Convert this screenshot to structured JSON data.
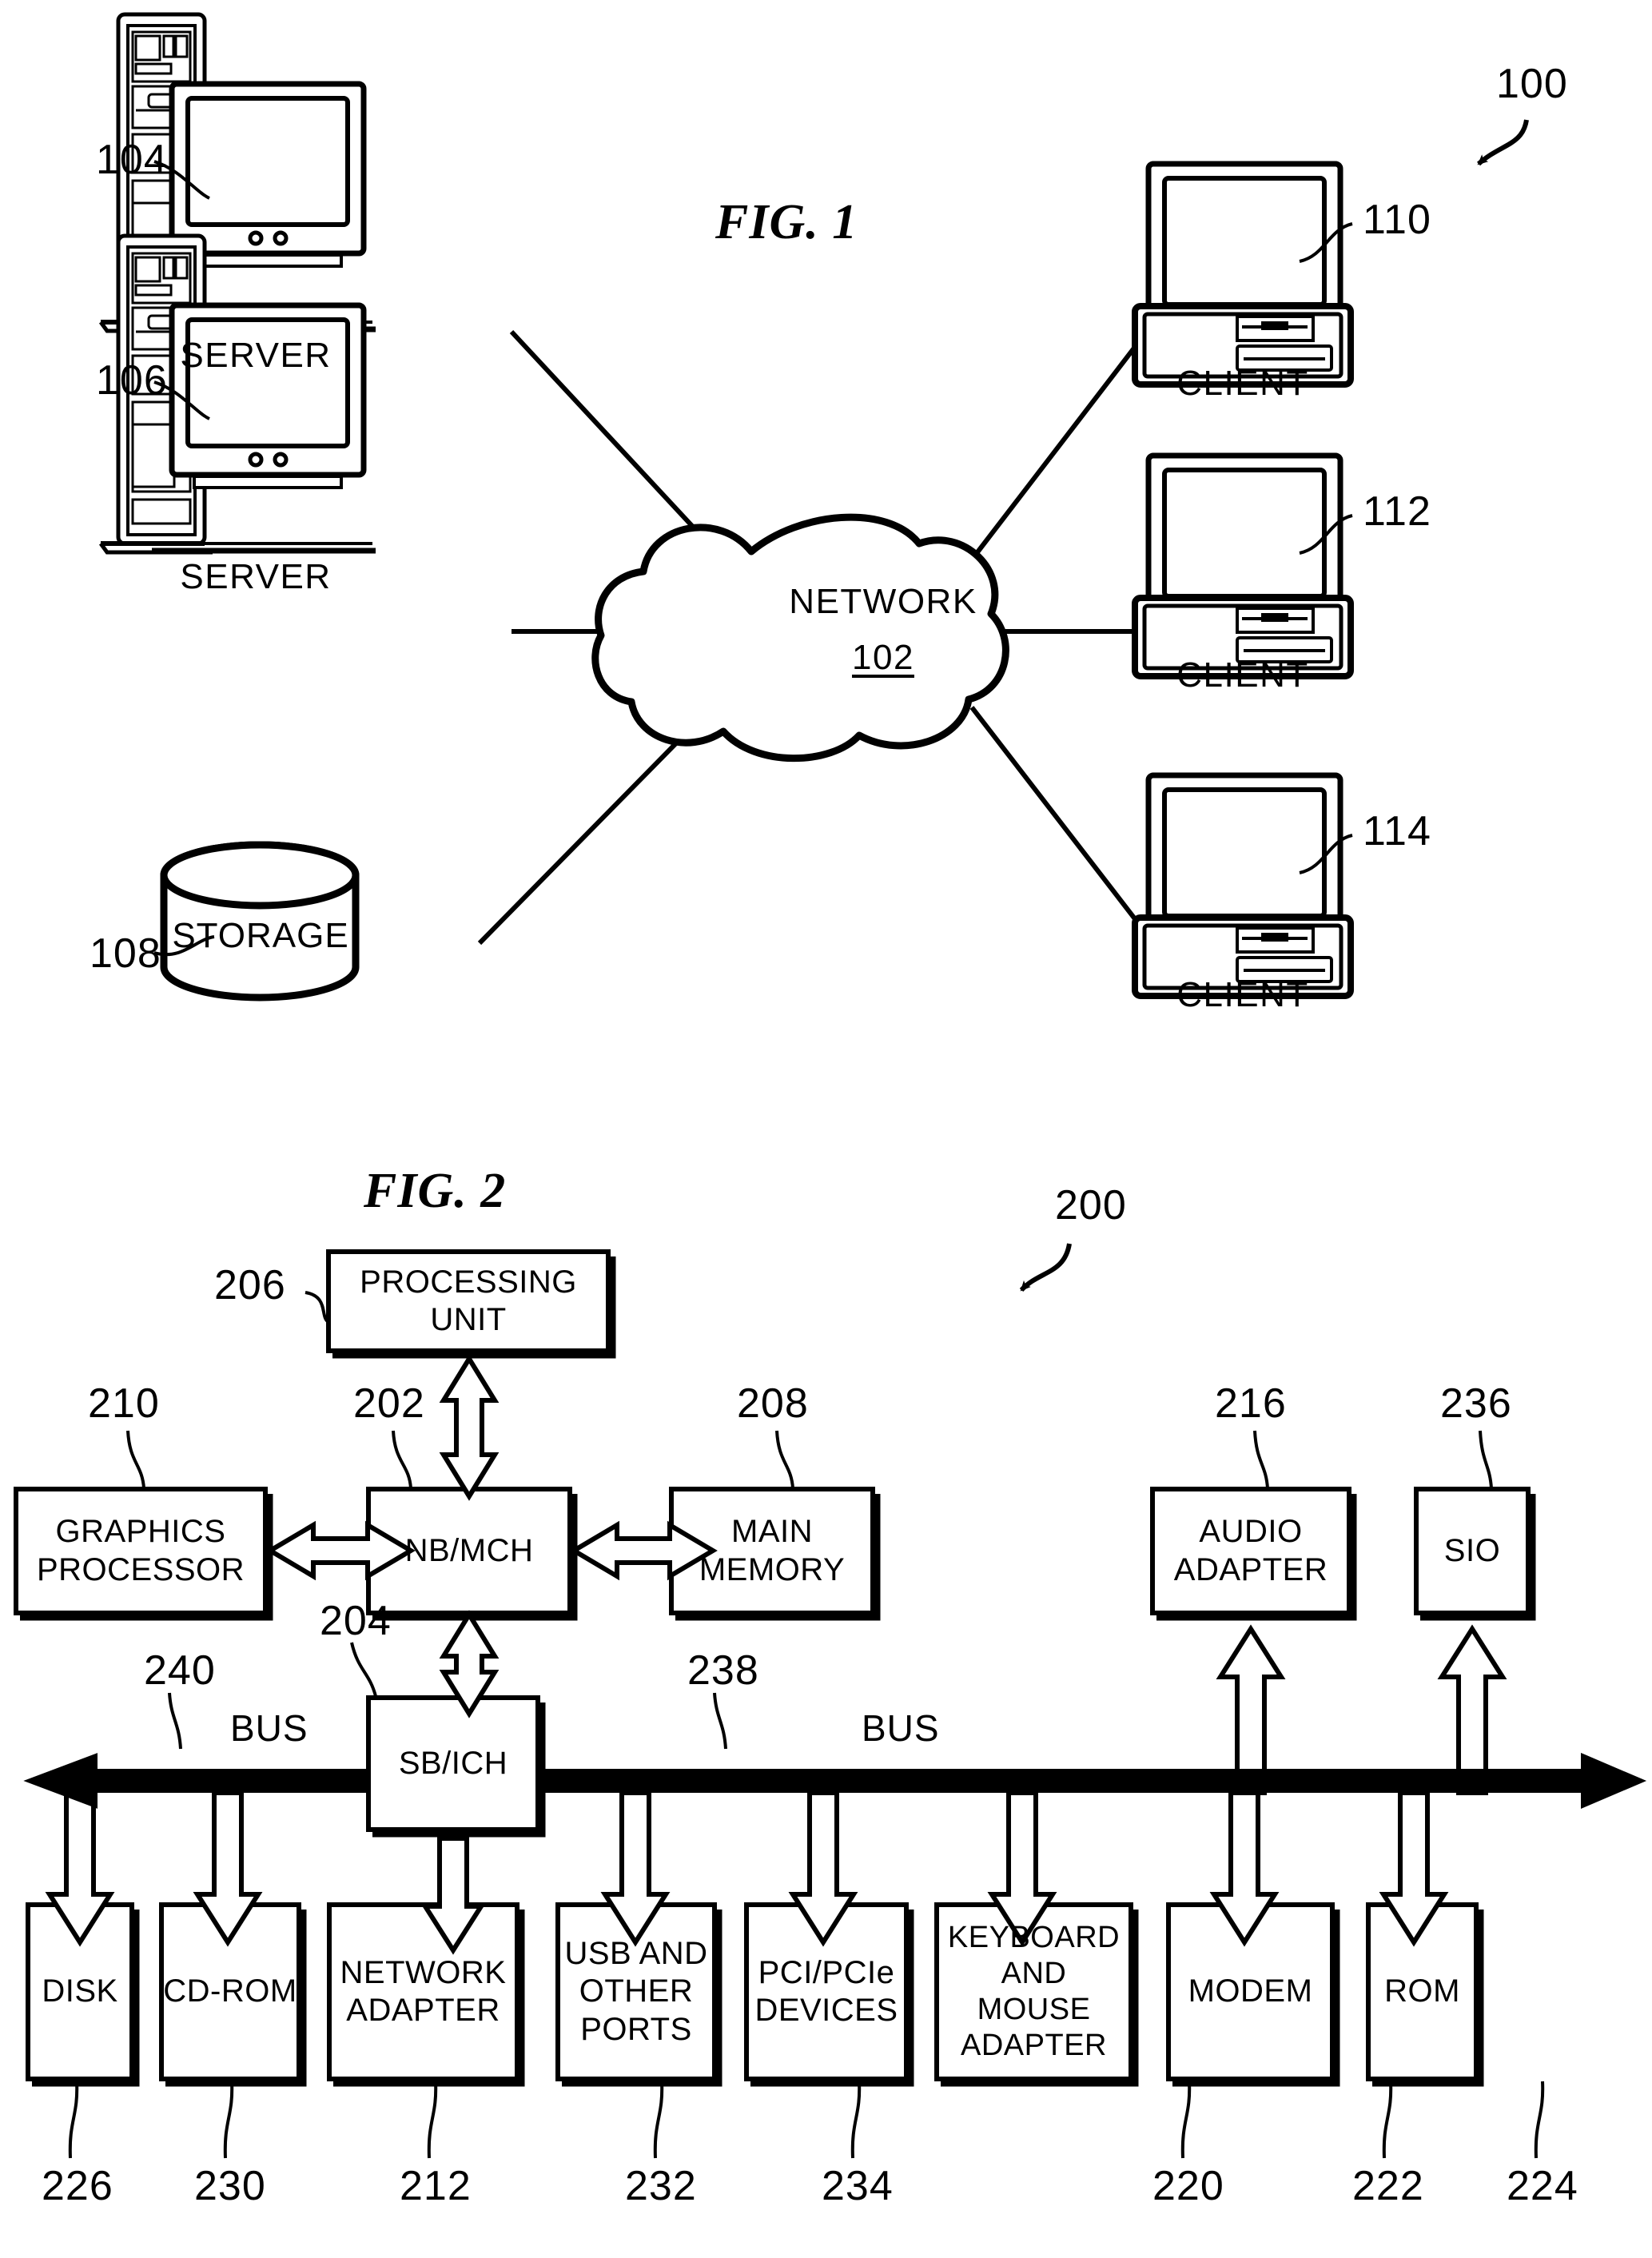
{
  "figures": [
    {
      "id": "fig1",
      "title": "FIG. 1",
      "system_ref": "100",
      "cloud": {
        "label": "NETWORK",
        "ref": "102"
      },
      "nodes": [
        {
          "name": "server-104",
          "label": "SERVER",
          "ref": "104"
        },
        {
          "name": "server-106",
          "label": "SERVER",
          "ref": "106"
        },
        {
          "name": "storage-108",
          "label": "STORAGE",
          "ref": "108"
        },
        {
          "name": "client-110",
          "label": "CLIENT",
          "ref": "110"
        },
        {
          "name": "client-112",
          "label": "CLIENT",
          "ref": "112"
        },
        {
          "name": "client-114",
          "label": "CLIENT",
          "ref": "114"
        }
      ]
    },
    {
      "id": "fig2",
      "title": "FIG. 2",
      "system_ref": "200",
      "bus_labels": [
        {
          "text": "BUS",
          "ref": "240"
        },
        {
          "text": "BUS",
          "ref": "238"
        }
      ],
      "blocks": [
        {
          "name": "processing-unit",
          "label": "PROCESSING\nUNIT",
          "ref": "206"
        },
        {
          "name": "nb-mch",
          "label": "NB/MCH",
          "ref": "202"
        },
        {
          "name": "graphics-processor",
          "label": "GRAPHICS\nPROCESSOR",
          "ref": "210"
        },
        {
          "name": "main-memory",
          "label": "MAIN\nMEMORY",
          "ref": "208"
        },
        {
          "name": "audio-adapter",
          "label": "AUDIO\nADAPTER",
          "ref": "216"
        },
        {
          "name": "sio",
          "label": "SIO",
          "ref": "236"
        },
        {
          "name": "sb-ich",
          "label": "SB/ICH",
          "ref": "204"
        },
        {
          "name": "disk",
          "label": "DISK",
          "ref": "226"
        },
        {
          "name": "cd-rom",
          "label": "CD-ROM",
          "ref": "230"
        },
        {
          "name": "network-adapter",
          "label": "NETWORK\nADAPTER",
          "ref": "212"
        },
        {
          "name": "usb-and-other-ports",
          "label": "USB AND\nOTHER\nPORTS",
          "ref": "232"
        },
        {
          "name": "pci-pcie-devices",
          "label": "PCI/PCIe\nDEVICES",
          "ref": "234"
        },
        {
          "name": "keyboard-mouse-adapter",
          "label": "KEYBOARD\nAND\nMOUSE\nADAPTER",
          "ref": "220"
        },
        {
          "name": "modem",
          "label": "MODEM",
          "ref": "222"
        },
        {
          "name": "rom",
          "label": "ROM",
          "ref": "224"
        }
      ]
    }
  ],
  "colors": {
    "ink": "#000000",
    "paper": "#ffffff"
  }
}
